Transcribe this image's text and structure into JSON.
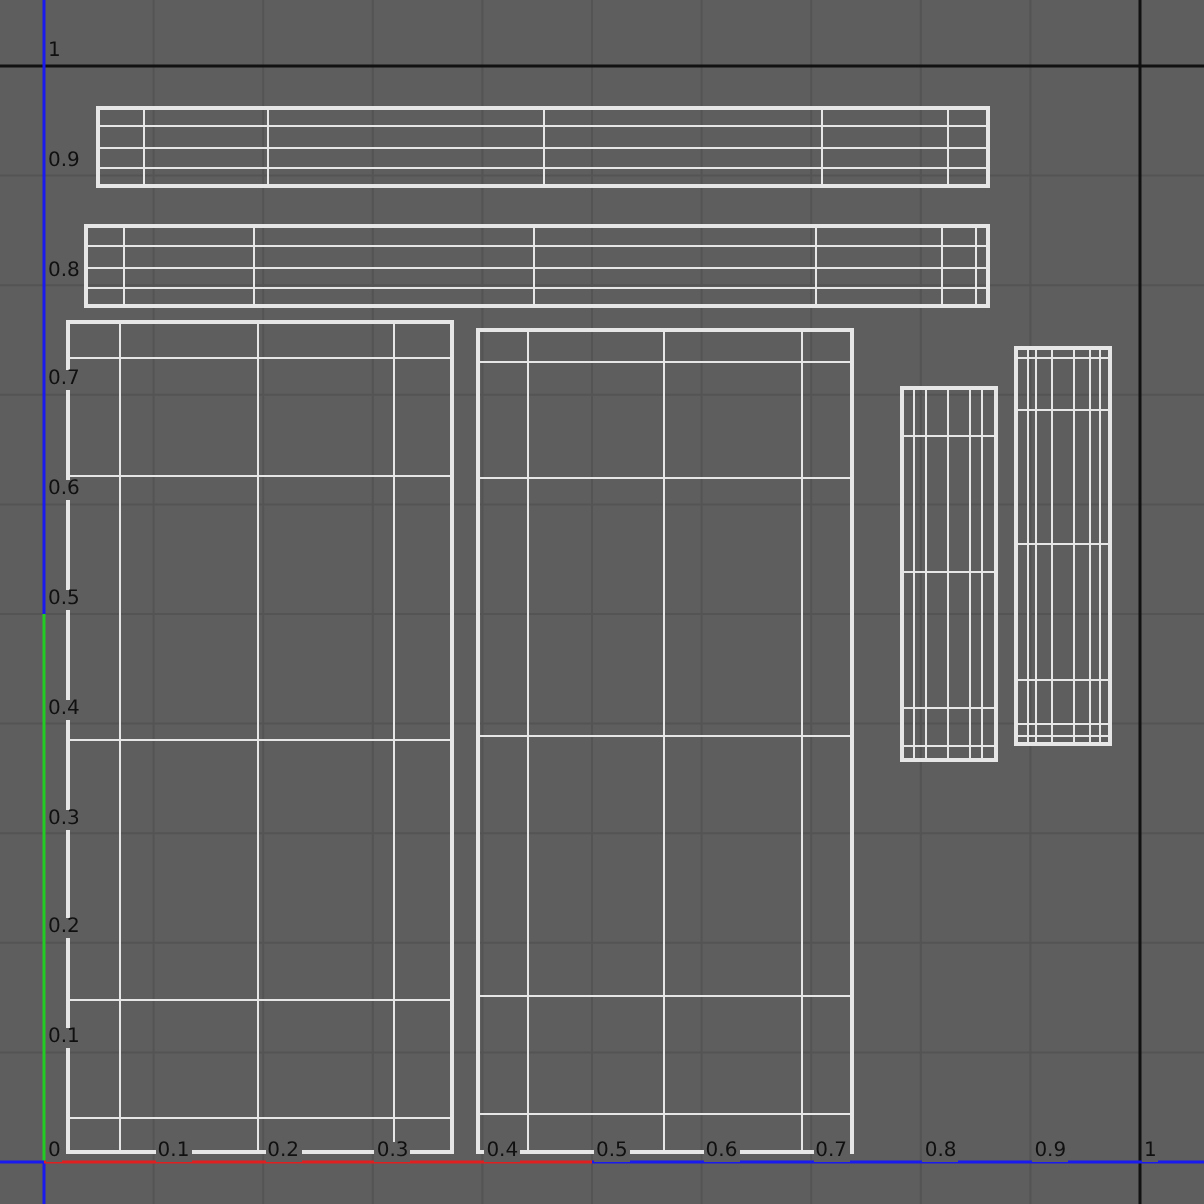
{
  "uv_editor": {
    "origin_label": "0",
    "x_axis_labels": [
      "0.1",
      "0.2",
      "0.3",
      "0.4",
      "0.5",
      "0.6",
      "0.7",
      "0.8",
      "0.9",
      "1"
    ],
    "y_axis_labels": [
      "1",
      "0.9",
      "0.8",
      "0.7",
      "0.6",
      "0.5",
      "0.4",
      "0.3",
      "0.2",
      "0.1"
    ]
  }
}
